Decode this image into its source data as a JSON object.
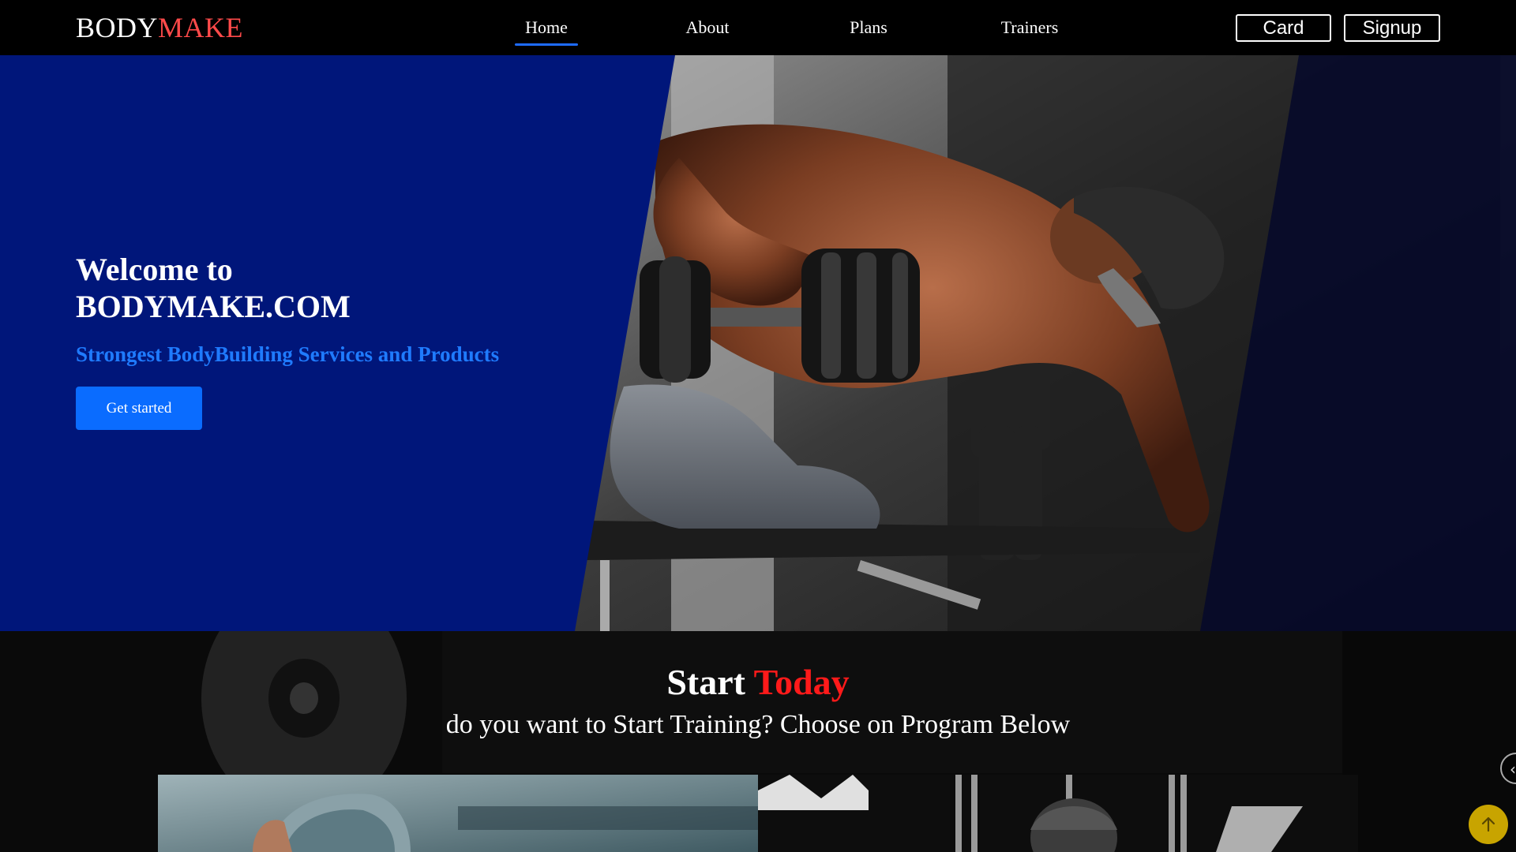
{
  "brand": {
    "part1": "BODY",
    "part2": "MAKE"
  },
  "nav": {
    "links": [
      {
        "label": "Home",
        "active": true
      },
      {
        "label": "About",
        "active": false
      },
      {
        "label": "Plans",
        "active": false
      },
      {
        "label": "Trainers",
        "active": false
      }
    ],
    "card_label": "Card",
    "signup_label": "Signup"
  },
  "hero": {
    "title_line1": "Welcome to",
    "title_line2": "BODYMAKE.COM",
    "subtitle": "Strongest BodyBuilding Services and Products",
    "cta_label": "Get started"
  },
  "start": {
    "title_word1": "Start",
    "title_word2": "Today",
    "subtitle": "do you want to Start Training? Choose on Program Below"
  },
  "icons": {
    "slider_prev": "chevron-left-icon",
    "scroll_top": "arrow-up-icon"
  },
  "colors": {
    "hero_blue": "#00167a",
    "accent_blue": "#1f7bff",
    "cta_blue": "#0a6cff",
    "brand_red": "#ff4a4a",
    "today_red": "#ff1a1a",
    "scroll_top_gold": "#c8a400"
  }
}
